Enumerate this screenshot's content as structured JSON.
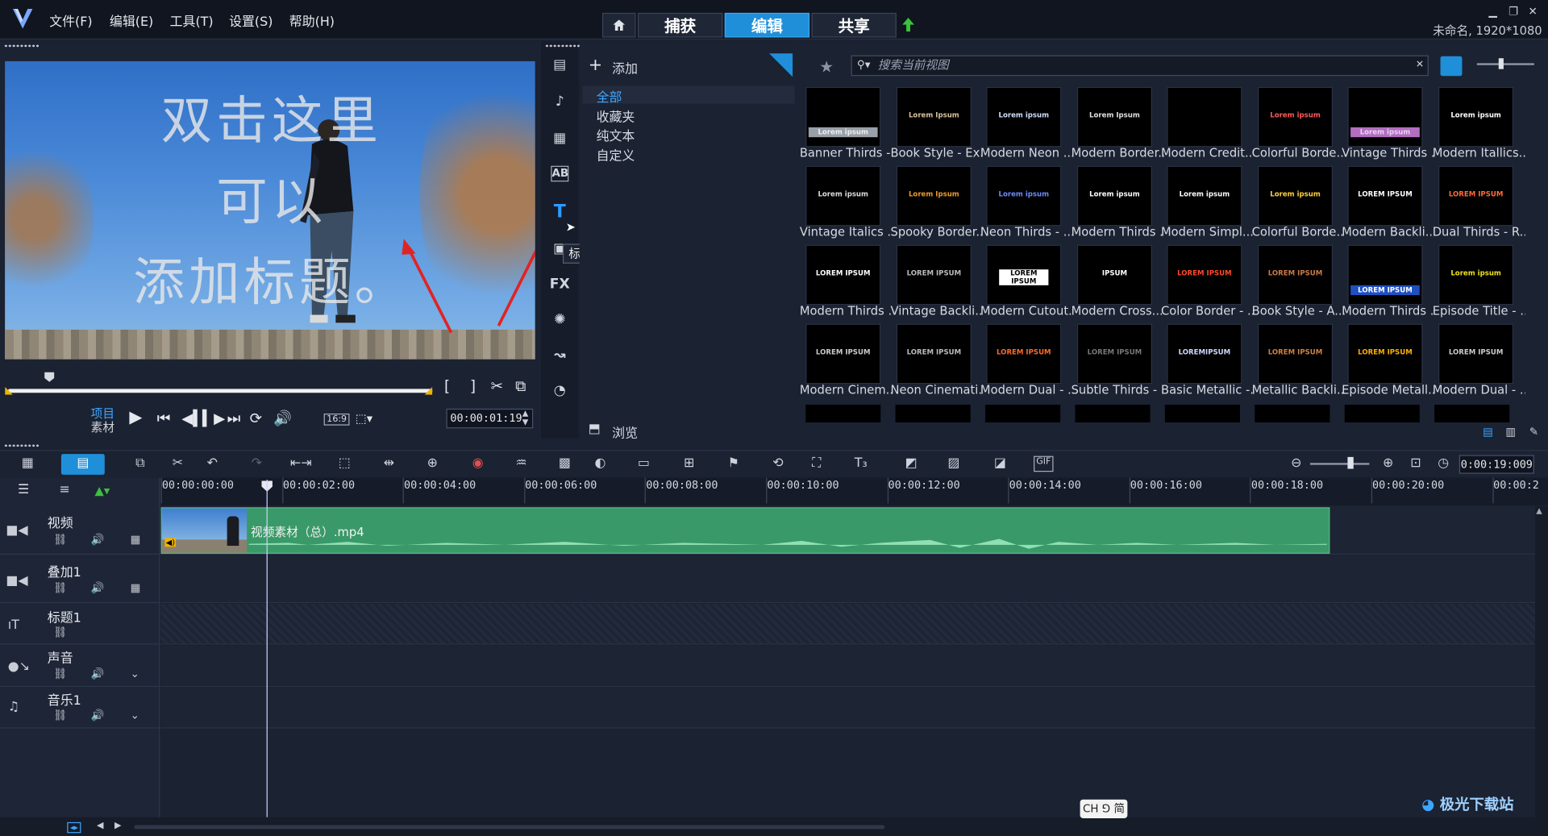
{
  "menu": {
    "items": [
      "文件(F)",
      "编辑(E)",
      "工具(T)",
      "设置(S)",
      "帮助(H)"
    ]
  },
  "nav_tabs": [
    {
      "label": "捕获",
      "active": false
    },
    {
      "label": "编辑",
      "active": true
    },
    {
      "label": "共享",
      "active": false
    }
  ],
  "project_info": "未命名, 1920*1080",
  "preview": {
    "title_overlay": [
      "双击这里",
      "可以",
      "添加标题。"
    ],
    "mode_project": "项目",
    "mode_clip": "素材",
    "aspect": "16:9",
    "timecode": "00:00:01:19"
  },
  "tooltip": "标题",
  "library": {
    "add_label": "添加",
    "tree": [
      {
        "label": "全部",
        "selected": true
      },
      {
        "label": "收藏夹",
        "selected": false
      },
      {
        "label": "纯文本",
        "selected": false
      },
      {
        "label": "自定义",
        "selected": false
      }
    ],
    "browse_label": "浏览",
    "search_placeholder": "搜索当前视图",
    "thumbnails": [
      {
        "label": "Banner Thirds -...",
        "sample": "Lorem ipsum"
      },
      {
        "label": "Book Style - Ex...",
        "sample": "Lorem Ipsum"
      },
      {
        "label": "Modern Neon ...",
        "sample": "Lorem ipsum"
      },
      {
        "label": "Modern Border...",
        "sample": "Lorem Ipsum"
      },
      {
        "label": "Modern Credit...",
        "sample": ""
      },
      {
        "label": "Colorful Borde...",
        "sample": "Lorem ipsum"
      },
      {
        "label": "Vintage Thirds ...",
        "sample": "Lorem ipsum"
      },
      {
        "label": "Modern Itallics...",
        "sample": "Lorem ipsum"
      },
      {
        "label": "Vintage Italics ...",
        "sample": "Lorem ipsum"
      },
      {
        "label": "Spooky Border...",
        "sample": "Lorem Ipsum"
      },
      {
        "label": "Neon Thirds - ...",
        "sample": "Lorem ipsum"
      },
      {
        "label": "Modern Thirds ...",
        "sample": "Lorem ipsum"
      },
      {
        "label": "Modern Simpl...",
        "sample": "Lorem ipsum"
      },
      {
        "label": "Colorful Borde...",
        "sample": "Lorem ipsum"
      },
      {
        "label": "Modern Backli...",
        "sample": "LOREM IPSUM"
      },
      {
        "label": "Dual Thirds - R...",
        "sample": "LOREM IPSUM"
      },
      {
        "label": "Modern Thirds ...",
        "sample": "LOREM IPSUM"
      },
      {
        "label": "Vintage Backli...",
        "sample": "LOREM IPSUM"
      },
      {
        "label": "Modern Cutout...",
        "sample": "LOREM IPSUM"
      },
      {
        "label": "Modern Cross...",
        "sample": "IPSUM"
      },
      {
        "label": "Color Border - ...",
        "sample": "LOREM IPSUM"
      },
      {
        "label": "Book Style - A...",
        "sample": "LOREM IPSUM"
      },
      {
        "label": "Modern Thirds ...",
        "sample": "LOREM IPSUM"
      },
      {
        "label": "Episode Title - ...",
        "sample": "Lorem ipsum"
      },
      {
        "label": "Modern Cinem...",
        "sample": "LOREM IPSUM"
      },
      {
        "label": "Neon Cinemati...",
        "sample": "LOREM IPSUM"
      },
      {
        "label": "Modern Dual - ...",
        "sample": "LOREM IPSUM"
      },
      {
        "label": "Subtle Thirds - ...",
        "sample": "LOREM IPSUM"
      },
      {
        "label": "Basic Metallic -...",
        "sample": "LOREMIPSUM"
      },
      {
        "label": "Metallic Backli...",
        "sample": "LOREM IPSUM"
      },
      {
        "label": "Episode Metall...",
        "sample": "LOREM IPSUM"
      },
      {
        "label": "Modern Dual - ...",
        "sample": "LOREM IPSUM"
      }
    ]
  },
  "timeline": {
    "zoom_timecode": "0:00:19:009",
    "ruler": [
      "00:00:00:00",
      "00:00:02:00",
      "00:00:04:00",
      "00:00:06:00",
      "00:00:08:00",
      "00:00:10:00",
      "00:00:12:00",
      "00:00:14:00",
      "00:00:16:00",
      "00:00:18:00",
      "00:00:20:00",
      "00:00:2"
    ],
    "tracks": [
      "视频",
      "叠加1",
      "标题1",
      "声音",
      "音乐1"
    ],
    "clip_name": "视频素材（总）.mp4"
  },
  "ime": "CH ⅁ 简",
  "watermark": "极光下载站",
  "colors": {
    "accent": "#1f8fd9",
    "clip": "#3a9968",
    "background": "#1b2232"
  }
}
